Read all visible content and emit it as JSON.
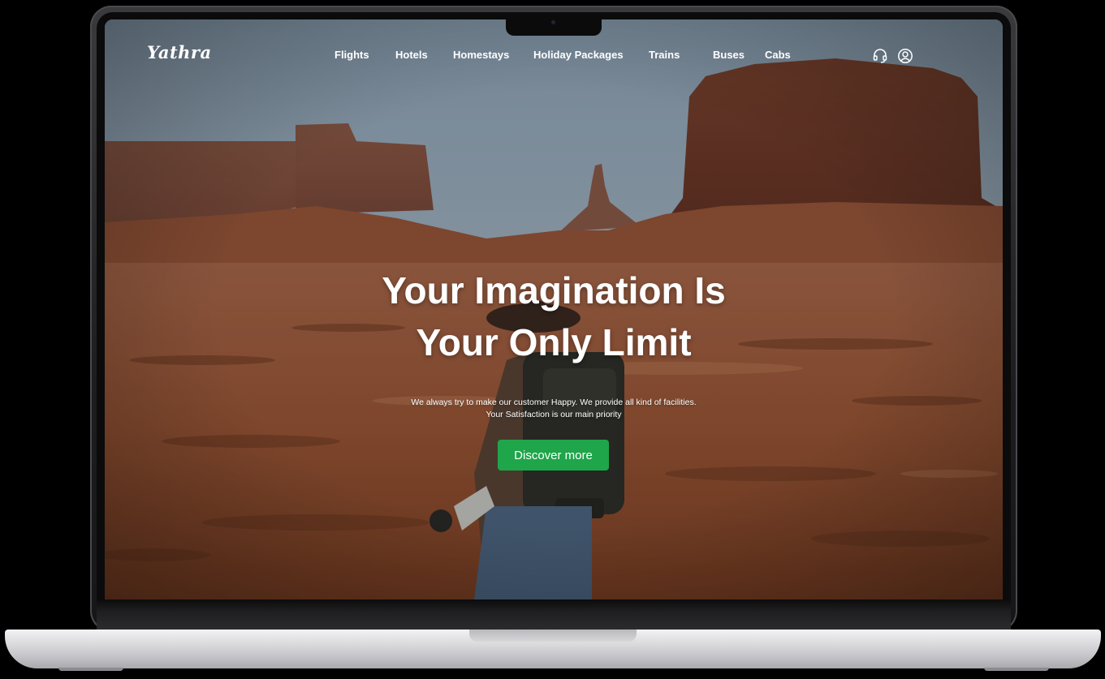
{
  "app": {
    "logo": "Yathra"
  },
  "nav": {
    "items": [
      {
        "label": "Flights"
      },
      {
        "label": "Hotels"
      },
      {
        "label": "Homestays"
      },
      {
        "label": "Holiday Packages"
      },
      {
        "label": "Trains"
      },
      {
        "label": "Buses"
      },
      {
        "label": "Cabs"
      }
    ],
    "icons": {
      "support": "headset-icon",
      "account": "user-circle-icon"
    }
  },
  "hero": {
    "title_line1": "Your Imagination Is",
    "title_line2": "Your Only Limit",
    "subtitle_line1": "We always try to make our customer Happy. We provide all kind of facilities.",
    "subtitle_line2": "Your Satisfaction is our main priority",
    "cta_label": "Discover more"
  },
  "colors": {
    "cta": "#1fa54a",
    "text": "#ffffff"
  }
}
